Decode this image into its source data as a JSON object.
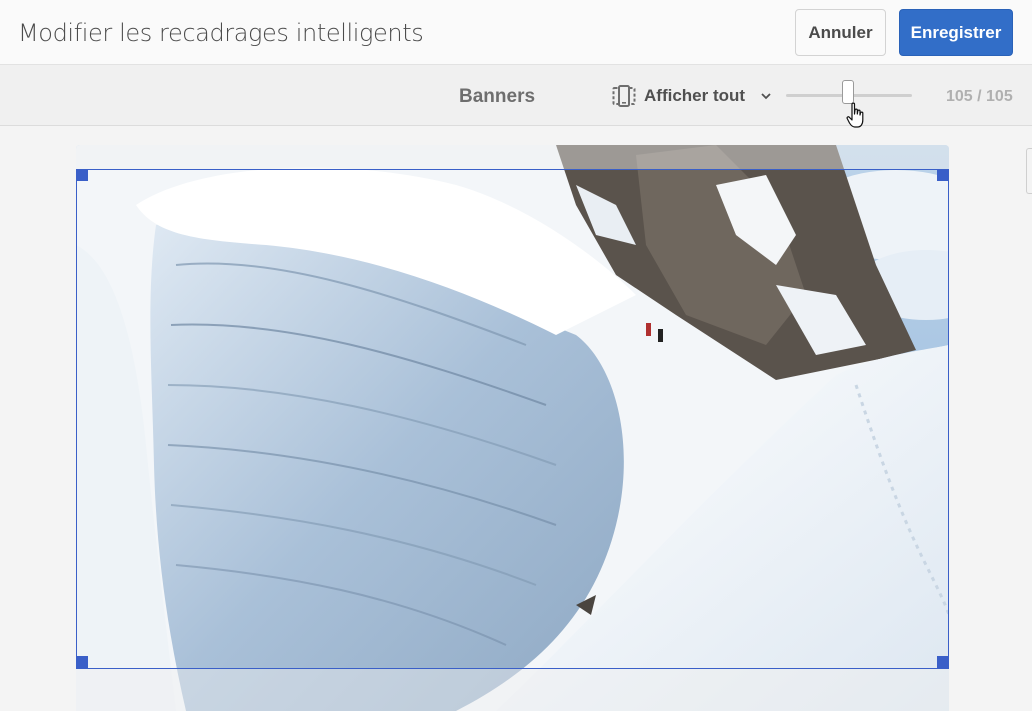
{
  "header": {
    "title": "Modifier les recadrages intelligents",
    "cancel_label": "Annuler",
    "save_label": "Enregistrer"
  },
  "toolbar": {
    "crop_name": "Banners",
    "view_label": "Afficher tout",
    "view_icon": "device-preview-icon",
    "slider_value": 105,
    "slider_max": 105,
    "counter_text": "105 / 105"
  },
  "colors": {
    "accent": "#326ec8",
    "crop_frame": "#3a5fc8"
  }
}
